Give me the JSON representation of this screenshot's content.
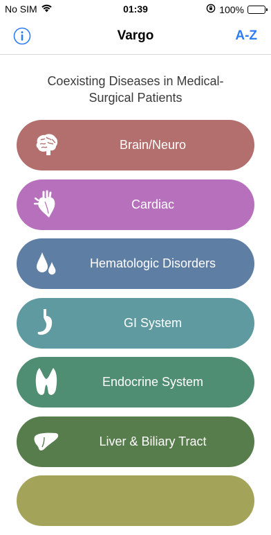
{
  "status_bar": {
    "carrier": "No SIM",
    "time": "01:39",
    "battery": "100%"
  },
  "nav": {
    "title": "Vargo",
    "right_button": "A-Z",
    "left_icon": "info-icon"
  },
  "subtitle": "Coexisting Diseases in Medical-Surgical Patients",
  "categories": [
    {
      "label": "Brain/Neuro",
      "icon": "brain-icon",
      "color": "#b36e6e"
    },
    {
      "label": "Cardiac",
      "icon": "heart-icon",
      "color": "#b670bc"
    },
    {
      "label": "Hematologic Disorders",
      "icon": "blood-drops-icon",
      "color": "#5f7ea3"
    },
    {
      "label": "GI System",
      "icon": "stomach-icon",
      "color": "#5f9aa0"
    },
    {
      "label": "Endocrine System",
      "icon": "thyroid-icon",
      "color": "#4f8e72"
    },
    {
      "label": "Liver & Biliary Tract",
      "icon": "liver-icon",
      "color": "#567d4b"
    },
    {
      "label": "",
      "icon": "",
      "color": "#a3a35a"
    }
  ],
  "colors": {
    "accent": "#2e7cf6"
  }
}
